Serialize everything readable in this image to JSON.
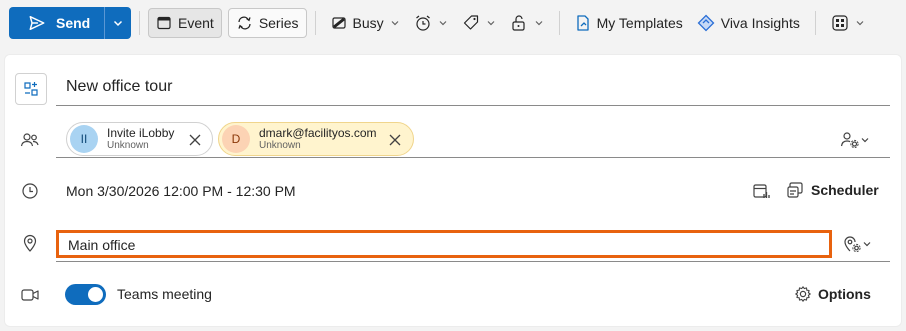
{
  "toolbar": {
    "send_label": "Send",
    "event_label": "Event",
    "series_label": "Series",
    "busy_label": "Busy",
    "templates_label": "My Templates",
    "insights_label": "Viva Insights"
  },
  "form": {
    "title": "New office tour",
    "attendees": [
      {
        "initials": "II",
        "name": "Invite iLobby",
        "status": "Unknown",
        "avatar_bg": "#a9d3f2",
        "avatar_fg": "#0e4775",
        "chip_bg": "#ffffff",
        "chip_border": "#d1d1d1"
      },
      {
        "initials": "D",
        "name": "dmark@facilityos.com",
        "status": "Unknown",
        "avatar_bg": "#fcd3b4",
        "avatar_fg": "#8a3707",
        "chip_bg": "#fff4ce",
        "chip_border": "#f0d58c"
      }
    ],
    "datetime": "Mon 3/30/2026 12:00 PM - 12:30 PM",
    "scheduler_label": "Scheduler",
    "location": "Main office",
    "teams_label": "Teams meeting",
    "teams_enabled": true,
    "options_label": "Options"
  },
  "colors": {
    "accent": "#0f6cbd",
    "focus_outline": "#e8620e"
  }
}
